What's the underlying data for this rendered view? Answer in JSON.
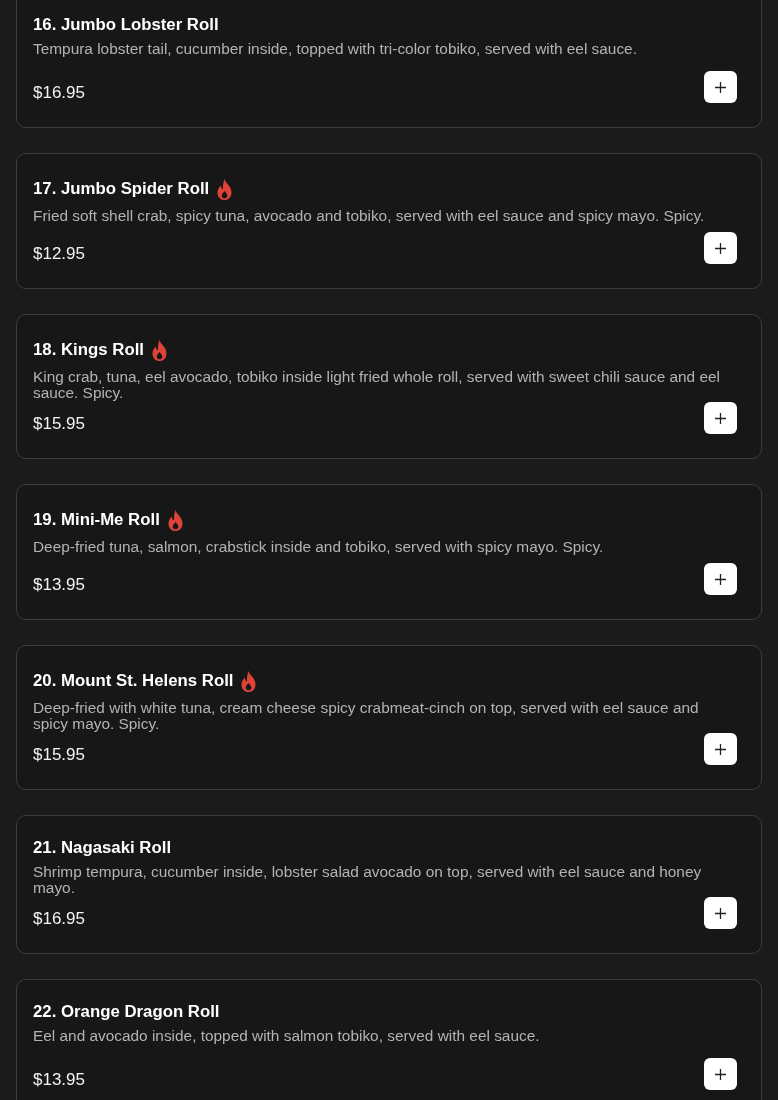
{
  "items": [
    {
      "title": "16. Jumbo Lobster Roll",
      "spicy": false,
      "description": "Tempura lobster tail, cucumber inside, topped with tri-color tobiko, served with eel sauce.",
      "price": "$16.95"
    },
    {
      "title": "17. Jumbo Spider Roll",
      "spicy": true,
      "description": "Fried soft shell crab, spicy tuna, avocado and tobiko, served with eel sauce and spicy mayo. Spicy.",
      "price": "$12.95"
    },
    {
      "title": "18. Kings Roll",
      "spicy": true,
      "description": "King crab, tuna, eel avocado, tobiko inside light fried whole roll, served with sweet chili sauce and eel sauce. Spicy.",
      "price": "$15.95"
    },
    {
      "title": "19. Mini-Me Roll",
      "spicy": true,
      "description": "Deep-fried tuna, salmon, crabstick inside and tobiko, served with spicy mayo. Spicy.",
      "price": "$13.95"
    },
    {
      "title": "20. Mount St. Helens Roll",
      "spicy": true,
      "description": "Deep-fried with white tuna, cream cheese spicy crabmeat-cinch on top, served with eel sauce and spicy mayo. Spicy.",
      "price": "$15.95"
    },
    {
      "title": "21. Nagasaki Roll",
      "spicy": false,
      "description": "Shrimp tempura, cucumber inside, lobster salad avocado on top, served with eel sauce and honey mayo.",
      "price": "$16.95"
    },
    {
      "title": "22. Orange Dragon Roll",
      "spicy": false,
      "description": "Eel and avocado inside, topped with salmon tobiko, served with eel sauce.",
      "price": "$13.95"
    }
  ]
}
